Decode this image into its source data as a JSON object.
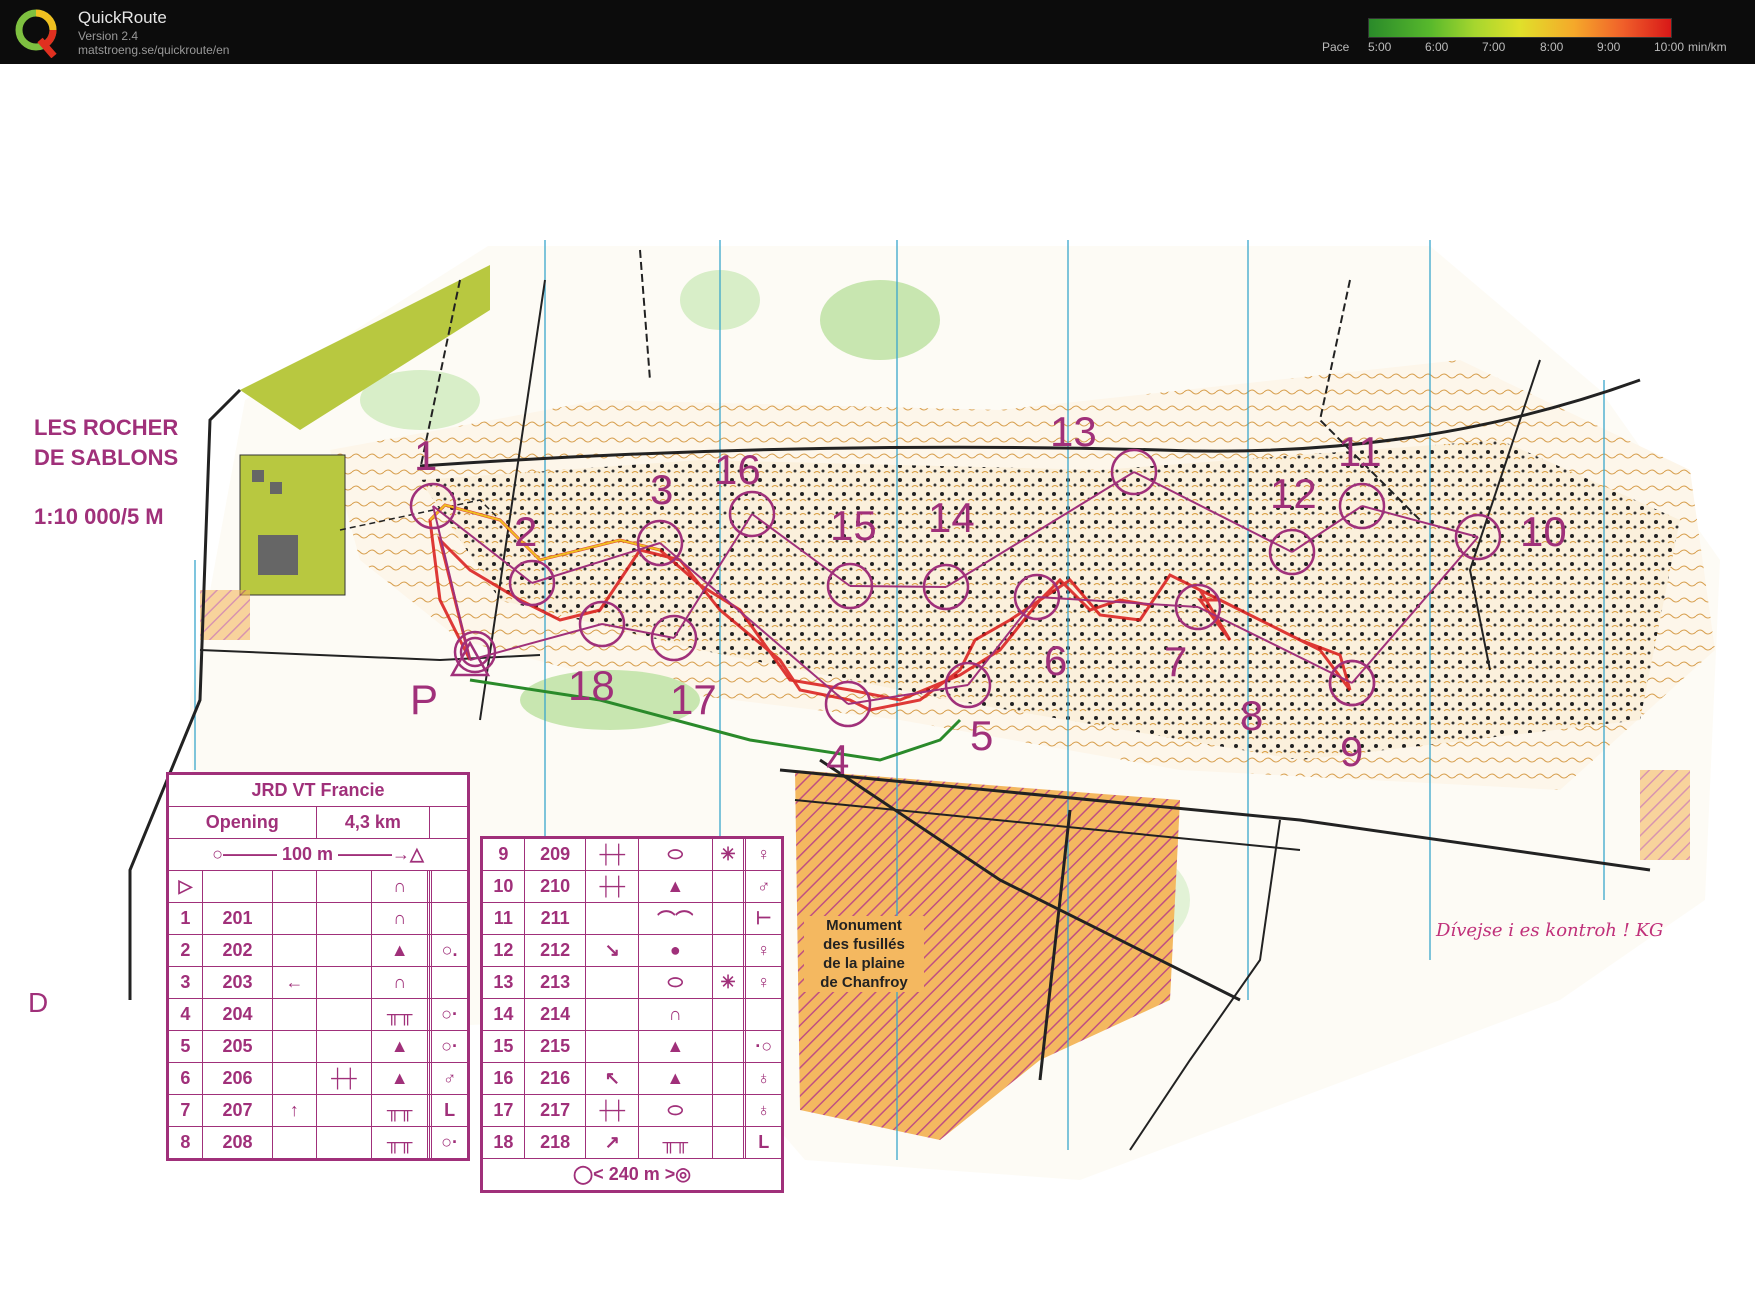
{
  "app": {
    "title": "QuickRoute",
    "version": "Version 2.4",
    "url": "matstroeng.se/quickroute/en"
  },
  "pace_legend": {
    "label": "Pace",
    "ticks": [
      "5:00",
      "6:00",
      "7:00",
      "8:00",
      "9:00",
      "10:00"
    ],
    "unit": "min/km",
    "colors": [
      "#2a8a2a",
      "#a6d62e",
      "#e0e02a",
      "#f5a82a",
      "#f0602a",
      "#d81818"
    ]
  },
  "map": {
    "title_line1": "LES ROCHER",
    "title_line2": "DE SABLONS",
    "scale": "1:10 000/5 M",
    "start_label": "P",
    "monument_line1": "Monument",
    "monument_line2": "des fusillés",
    "monument_line3": "de la plaine",
    "monument_line4": "de Chanfroy",
    "note": "Dívejse i es kontroh ! KG",
    "controls": [
      "1",
      "2",
      "3",
      "4",
      "5",
      "6",
      "7",
      "8",
      "9",
      "10",
      "11",
      "12",
      "13",
      "14",
      "15",
      "16",
      "17",
      "18"
    ],
    "route_color": "#d81818",
    "course_color": "#a0307a"
  },
  "description_left": {
    "course": "JRD VT Francie",
    "class": "Opening",
    "length": "4,3 km",
    "start_dist": "100 m",
    "rows": [
      {
        "n": "1",
        "code": "201",
        "c": "",
        "d": "",
        "e": "∩",
        "f": "",
        "g": "",
        "h": ""
      },
      {
        "n": "2",
        "code": "202",
        "c": "",
        "d": "",
        "e": "▲",
        "f": "",
        "g": "",
        "h": "○."
      },
      {
        "n": "3",
        "code": "203",
        "c": "←",
        "d": "",
        "e": "∩",
        "f": "",
        "g": "",
        "h": ""
      },
      {
        "n": "4",
        "code": "204",
        "c": "",
        "d": "",
        "e": "╥╥",
        "f": "",
        "g": "",
        "h": "○·"
      },
      {
        "n": "5",
        "code": "205",
        "c": "",
        "d": "",
        "e": "▲",
        "f": "",
        "g": "",
        "h": "○·"
      },
      {
        "n": "6",
        "code": "206",
        "c": "",
        "d": "┼┼",
        "e": "▲",
        "f": "",
        "g": "",
        "h": "♂"
      },
      {
        "n": "7",
        "code": "207",
        "c": "↑",
        "d": "",
        "e": "╥╥",
        "f": "",
        "g": "",
        "h": "L"
      },
      {
        "n": "8",
        "code": "208",
        "c": "",
        "d": "",
        "e": "╥╥",
        "f": "",
        "g": "",
        "h": "○·"
      }
    ]
  },
  "description_right": {
    "finish_dist": "240 m",
    "rows": [
      {
        "n": "9",
        "code": "209",
        "c": "┼┼",
        "d": "⬭",
        "e": "✳",
        "f": "",
        "g": "♀"
      },
      {
        "n": "10",
        "code": "210",
        "c": "┼┼",
        "d": "▲",
        "e": "",
        "f": "",
        "g": "♂"
      },
      {
        "n": "11",
        "code": "211",
        "c": "",
        "d": "⌒⌒",
        "e": "",
        "f": "",
        "g": "⊢"
      },
      {
        "n": "12",
        "code": "212",
        "c": "↘",
        "d": "●",
        "e": "",
        "f": "",
        "g": "♀"
      },
      {
        "n": "13",
        "code": "213",
        "c": "",
        "d": "⬭",
        "e": "✳",
        "f": "",
        "g": "♀"
      },
      {
        "n": "14",
        "code": "214",
        "c": "",
        "d": "∩",
        "e": "",
        "f": "",
        "g": ""
      },
      {
        "n": "15",
        "code": "215",
        "c": "",
        "d": "▲",
        "e": "",
        "f": "",
        "g": "·○"
      },
      {
        "n": "16",
        "code": "216",
        "c": "↖",
        "d": "▲",
        "e": "",
        "f": "",
        "g": "♁"
      },
      {
        "n": "17",
        "code": "217",
        "c": "┼┼",
        "d": "⬭",
        "e": "",
        "f": "",
        "g": "♁"
      },
      {
        "n": "18",
        "code": "218",
        "c": "↗",
        "d": "╥╥",
        "e": "",
        "f": "",
        "g": "L"
      }
    ]
  }
}
